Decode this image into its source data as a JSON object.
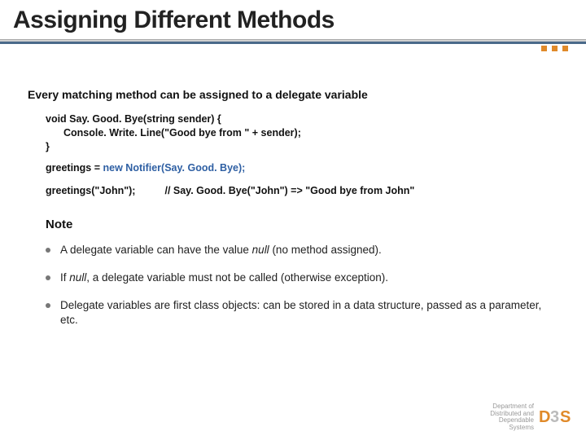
{
  "title": "Assigning Different Methods",
  "lead": "Every matching method can be assigned to a delegate variable",
  "code": {
    "l1": "void Say. Good. Bye(string sender) {",
    "l2": "Console. Write. Line(\"Good bye from \" + sender);",
    "l3": "}"
  },
  "assign": {
    "lhs": "greetings = ",
    "rhs": "new Notifier(Say. Good. Bye);"
  },
  "call": {
    "expr": "greetings(\"John\");",
    "comment": "// Say. Good. Bye(\"John\") => \"Good bye from John\""
  },
  "note_heading": "Note",
  "notes": [
    {
      "pre": "A delegate variable can have the value ",
      "em": "null",
      "post": " (no method assigned)."
    },
    {
      "pre": "If ",
      "em": "null",
      "post": ", a delegate variable must not be called (otherwise exception)."
    },
    {
      "pre": "Delegate variables are first class objects: can be stored in a data structure, passed as a parameter, etc.",
      "em": "",
      "post": ""
    }
  ],
  "footer": {
    "line1": "Department of",
    "line2": "Distributed and",
    "line3": "Dependable",
    "line4": "Systems"
  }
}
